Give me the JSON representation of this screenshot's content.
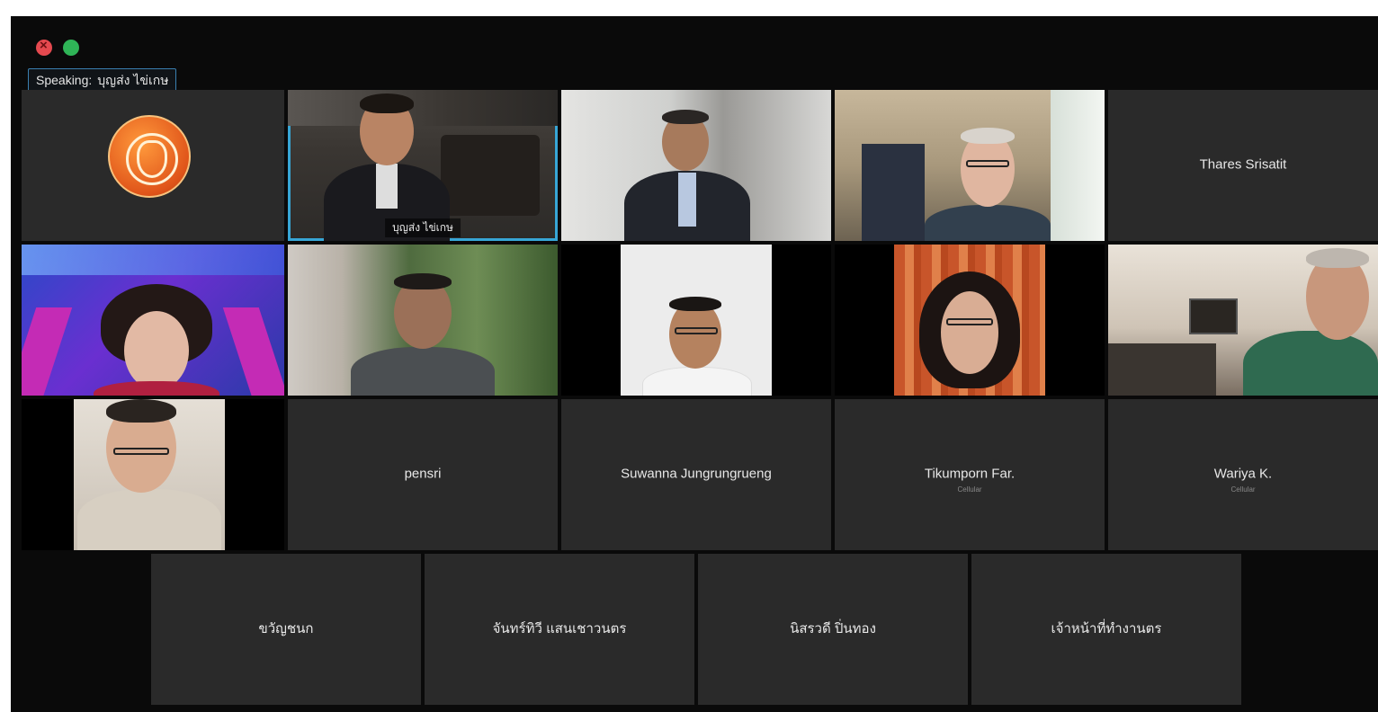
{
  "window": {
    "speaking_label": "Speaking:",
    "speaking_name": "บุญส่ง ไข่เกษ"
  },
  "colors": {
    "active_speaker_border": "#37a6d6",
    "tile_background": "#2a2a2a",
    "window_background": "#0a0a0a"
  },
  "participants": {
    "p_logo": {
      "icon": "organization-emblem-icon"
    },
    "p_speaker": {
      "caption": "บุญส่ง ไข่เกษ"
    },
    "p_thares": {
      "name": "Thares Srisatit"
    },
    "p_pensri": {
      "name": "pensri"
    },
    "p_suwanna": {
      "name": "Suwanna Jungrungrueng"
    },
    "p_tikumporn": {
      "name": "Tikumporn Far.",
      "sub": "Cellular"
    },
    "p_wariya": {
      "name": "Wariya K.",
      "sub": "Cellular"
    },
    "p_row4_1": {
      "name": "ขวัญชนก"
    },
    "p_row4_2": {
      "name": "จันทร์ทิวี แสนเชาวนตร"
    },
    "p_row4_3": {
      "name": "นิสรวดี ปิ่นทอง"
    },
    "p_row4_4": {
      "name": "เจ้าหน้าที่ทำงานตร"
    }
  }
}
